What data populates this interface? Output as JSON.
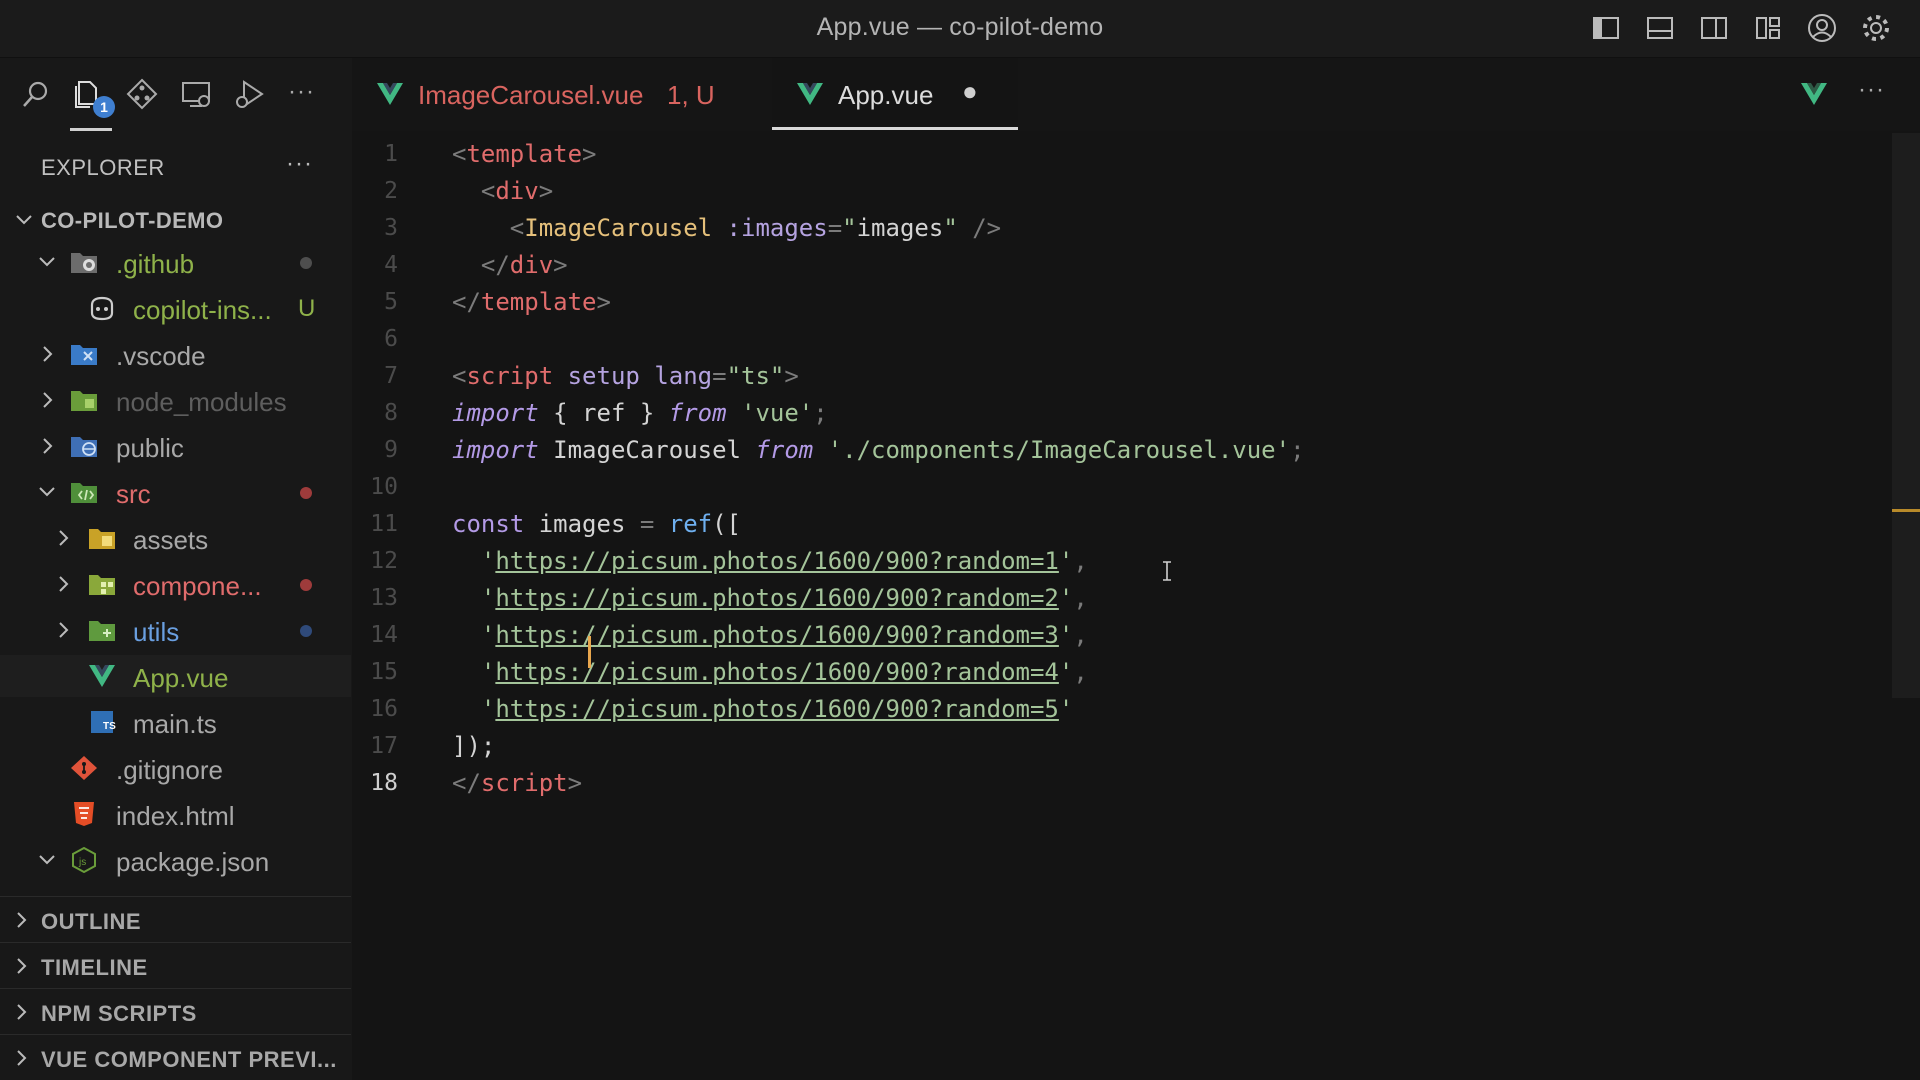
{
  "window": {
    "title": "App.vue — co-pilot-demo"
  },
  "titlebar_icons": [
    "toggle-primary-sidebar-icon",
    "toggle-panel-icon",
    "toggle-secondary-sidebar-icon",
    "customize-layout-icon",
    "account-icon",
    "settings-gear-icon"
  ],
  "activity_bar": {
    "icons": [
      "search-icon",
      "explorer-icon",
      "source-control-icon",
      "remote-explorer-icon",
      "run-debug-icon"
    ],
    "explorer_badge": "1",
    "more": "···"
  },
  "sidebar": {
    "title": "EXPLORER",
    "more": "···",
    "project": "CO-PILOT-DEMO",
    "items": [
      {
        "label": ".github",
        "color": "#8fb24a",
        "dot": "#4e4e4e",
        "expanded": true
      },
      {
        "label": "copilot-ins...",
        "color": "#8fb24a",
        "status": "U"
      },
      {
        "label": ".vscode",
        "color": "#a8a8a8"
      },
      {
        "label": "node_modules",
        "color": "#5e5e5e"
      },
      {
        "label": "public",
        "color": "#a8a8a8"
      },
      {
        "label": "src",
        "color": "#e06c6c",
        "dot": "#9e3b3b",
        "expanded": true
      },
      {
        "label": "assets",
        "color": "#a8a8a8"
      },
      {
        "label": "compone...",
        "color": "#e06c6c",
        "dot": "#9e3b3b"
      },
      {
        "label": "utils",
        "color": "#6a9fe0",
        "dot": "#2f4a7a"
      },
      {
        "label": "App.vue",
        "color": "#8fb24a"
      },
      {
        "label": "main.ts",
        "color": "#a8a8a8"
      },
      {
        "label": ".gitignore",
        "color": "#a8a8a8"
      },
      {
        "label": "index.html",
        "color": "#a8a8a8"
      },
      {
        "label": "package.json",
        "color": "#a8a8a8",
        "expanded": true
      }
    ],
    "panels": [
      "OUTLINE",
      "TIMELINE",
      "NPM SCRIPTS",
      "VUE COMPONENT PREVI..."
    ]
  },
  "tabs": [
    {
      "label": "ImageCarousel.vue",
      "suffix": "1, U",
      "color": "#d9645f"
    },
    {
      "label": "App.vue",
      "modified_dot": "●",
      "color": "#dcdcdc"
    }
  ],
  "editor": {
    "line_numbers": [
      "1",
      "2",
      "3",
      "4",
      "5",
      "6",
      "7",
      "8",
      "9",
      "10",
      "11",
      "12",
      "13",
      "14",
      "15",
      "16",
      "17",
      "18"
    ],
    "active_line": "18",
    "lines": [
      [
        [
          "g",
          "<"
        ],
        [
          "tag",
          "template"
        ],
        [
          "g",
          ">"
        ]
      ],
      [
        [
          "g",
          "  <"
        ],
        [
          "tag",
          "div"
        ],
        [
          "g",
          ">"
        ]
      ],
      [
        [
          "g",
          "    <"
        ],
        [
          "comp",
          "ImageCarousel"
        ],
        [
          "id",
          " "
        ],
        [
          "attr",
          ":images"
        ],
        [
          "g",
          "="
        ],
        [
          "str",
          "\""
        ],
        [
          "id",
          "images"
        ],
        [
          "str",
          "\""
        ],
        [
          "id",
          " "
        ],
        [
          "g",
          "/>"
        ]
      ],
      [
        [
          "g",
          "  </"
        ],
        [
          "tag",
          "div"
        ],
        [
          "g",
          ">"
        ]
      ],
      [
        [
          "g",
          "</"
        ],
        [
          "tag",
          "template"
        ],
        [
          "g",
          ">"
        ]
      ],
      [],
      [
        [
          "g",
          "<"
        ],
        [
          "tag",
          "script"
        ],
        [
          "id",
          " "
        ],
        [
          "attr",
          "setup"
        ],
        [
          "id",
          " "
        ],
        [
          "attr",
          "lang"
        ],
        [
          "g",
          "="
        ],
        [
          "str",
          "\"ts\""
        ],
        [
          "g",
          ">"
        ]
      ],
      [
        [
          "kw",
          "import"
        ],
        [
          "id",
          " { ref } "
        ],
        [
          "kw",
          "from"
        ],
        [
          "id",
          " "
        ],
        [
          "str",
          "'vue'"
        ],
        [
          "g",
          ";"
        ]
      ],
      [
        [
          "kw",
          "import"
        ],
        [
          "id",
          " ImageCarousel "
        ],
        [
          "kw",
          "from"
        ],
        [
          "id",
          " "
        ],
        [
          "str",
          "'./components/ImageCarousel.vue'"
        ],
        [
          "g",
          ";"
        ]
      ],
      [],
      [
        [
          "kw2",
          "const"
        ],
        [
          "id",
          " images "
        ],
        [
          "g",
          "="
        ],
        [
          "id",
          " "
        ],
        [
          "fn",
          "ref"
        ],
        [
          "id",
          "(["
        ]
      ],
      [
        [
          "str",
          "  '"
        ],
        [
          "url",
          "https://picsum.photos/1600/900?random=1"
        ],
        [
          "str",
          "'"
        ],
        [
          "g",
          ","
        ]
      ],
      [
        [
          "str",
          "  '"
        ],
        [
          "url",
          "https://picsum.photos/1600/900?random=2"
        ],
        [
          "str",
          "'"
        ],
        [
          "g",
          ","
        ]
      ],
      [
        [
          "str",
          "  '"
        ],
        [
          "url",
          "https://picsum.photos/1600/900?random=3"
        ],
        [
          "str",
          "'"
        ],
        [
          "g",
          ","
        ]
      ],
      [
        [
          "str",
          "  '"
        ],
        [
          "url",
          "https://picsum.photos/1600/900?random=4"
        ],
        [
          "str",
          "'"
        ],
        [
          "g",
          ","
        ]
      ],
      [
        [
          "str",
          "  '"
        ],
        [
          "url",
          "https://picsum.photos/1600/900?random=5"
        ],
        [
          "str",
          "'"
        ]
      ],
      [
        [
          "id",
          "]);"
        ]
      ],
      [
        [
          "g",
          "</"
        ],
        [
          "tag",
          "script"
        ],
        [
          "g",
          ">"
        ]
      ]
    ]
  }
}
